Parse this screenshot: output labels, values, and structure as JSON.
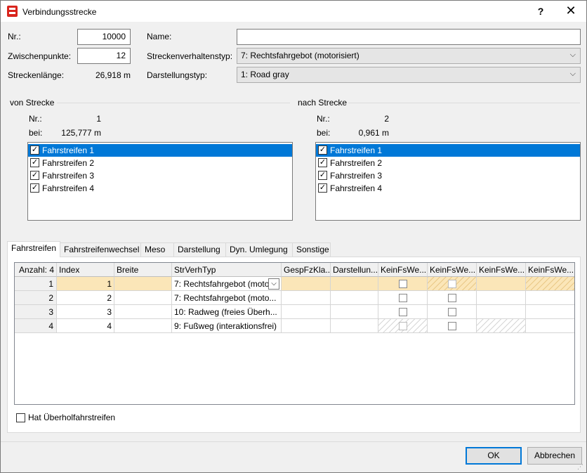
{
  "window": {
    "title": "Verbindungsstrecke",
    "help_label": "?",
    "close_label": "✕"
  },
  "general": {
    "nr_label": "Nr.:",
    "nr_value": "10000",
    "zwischenpunkte_label": "Zwischenpunkte:",
    "zwischenpunkte_value": "12",
    "streckenlaenge_label": "Streckenlänge:",
    "streckenlaenge_value": "26,918 m",
    "name_label": "Name:",
    "name_value": "",
    "streckenverhaltenstyp_label": "Streckenverhaltenstyp:",
    "streckenverhaltenstyp_value": "7: Rechtsfahrgebot (motorisiert)",
    "darstellungstyp_label": "Darstellungstyp:",
    "darstellungstyp_value": "1: Road gray"
  },
  "von_strecke": {
    "group_label": "von Strecke",
    "nr_label": "Nr.:",
    "nr_value": "1",
    "bei_label": "bei:",
    "bei_value": "125,777 m",
    "lanes": [
      "Fahrstreifen 1",
      "Fahrstreifen 2",
      "Fahrstreifen 3",
      "Fahrstreifen 4"
    ]
  },
  "nach_strecke": {
    "group_label": "nach Strecke",
    "nr_label": "Nr.:",
    "nr_value": "2",
    "bei_label": "bei:",
    "bei_value": "0,961 m",
    "lanes": [
      "Fahrstreifen 1",
      "Fahrstreifen 2",
      "Fahrstreifen 3",
      "Fahrstreifen 4"
    ]
  },
  "tabs": [
    "Fahrstreifen",
    "Fahrstreifenwechsel",
    "Meso",
    "Darstellung",
    "Dyn. Umlegung",
    "Sonstige"
  ],
  "grid": {
    "headers": [
      "Anzahl: 4",
      "Index",
      "Breite",
      "StrVerhTyp",
      "GespFzKla...",
      "Darstellun...",
      "KeinFsWe...",
      "KeinFsWe...",
      "KeinFsWe...",
      "KeinFsWe..."
    ],
    "rows": [
      {
        "num": "1",
        "index": "1",
        "breite": "",
        "strverhtyp": "7:  Rechtsfahrgebot (moto"
      },
      {
        "num": "2",
        "index": "2",
        "breite": "",
        "strverhtyp": "7:  Rechtsfahrgebot (moto..."
      },
      {
        "num": "3",
        "index": "3",
        "breite": "",
        "strverhtyp": "10:  Radweg (freies Überh..."
      },
      {
        "num": "4",
        "index": "4",
        "breite": "",
        "strverhtyp": "9: Fußweg (interaktionsfrei)"
      }
    ]
  },
  "ueberhol_label": "Hat Überholfahrstreifen",
  "buttons": {
    "ok": "OK",
    "abbrechen": "Abbrechen"
  },
  "colors": {
    "selection": "#0078d7",
    "row_highlight": "#fbe6b8"
  }
}
